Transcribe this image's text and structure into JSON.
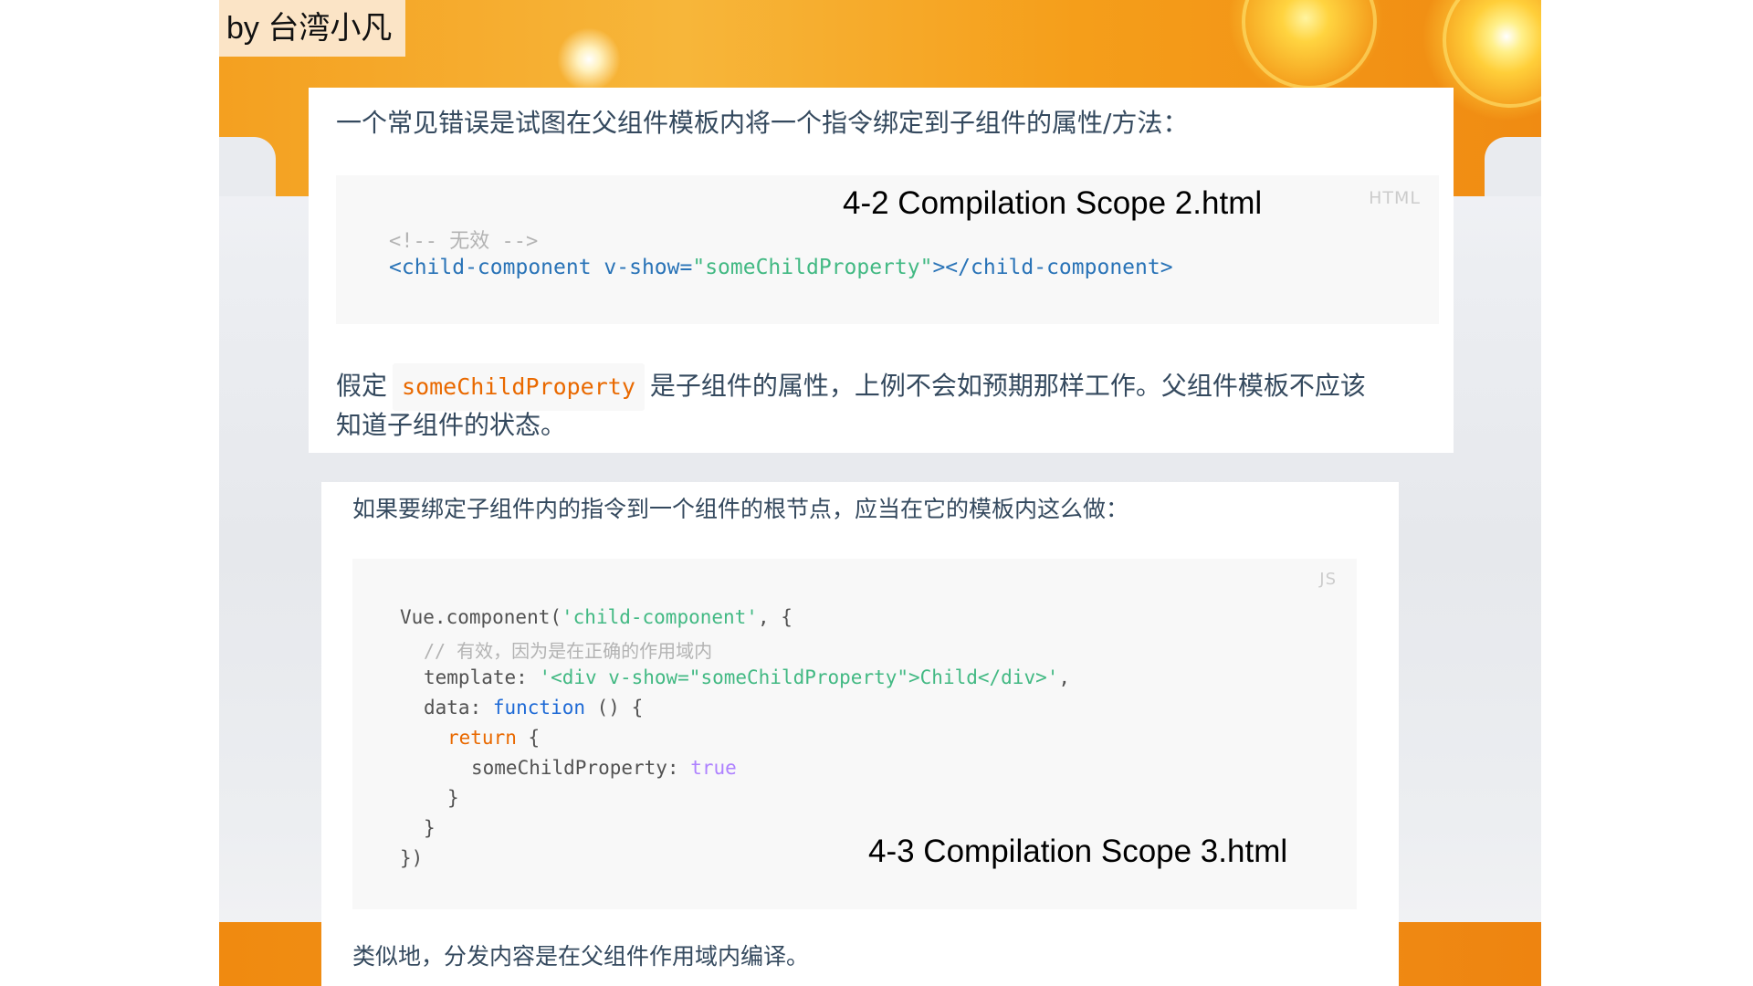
{
  "author_tag": "by 台湾小凡",
  "section1": {
    "intro": "一个常见错误是试图在父组件模板内将一个指令绑定到子组件的属性/方法：",
    "code_lang": "HTML",
    "file_label": "4-2 Compilation Scope 2.html",
    "code_comment": "<!-- 无效 -->",
    "code_line_open": "<child-component v-show=",
    "code_line_value": "\"someChildProperty\"",
    "code_line_close": "></child-component>",
    "para_before": "假定",
    "inline_code": "someChildProperty",
    "para_after": "是子组件的属性，上例不会如预期那样工作。父组件模板不应该",
    "para_line2": "知道子组件的状态。"
  },
  "section2": {
    "intro": "如果要绑定子组件内的指令到一个组件的根节点，应当在它的模板内这么做：",
    "code_lang": "JS",
    "file_label": "4-3 Compilation Scope 3.html",
    "l1_a": "Vue.component(",
    "l1_b": "'child-component'",
    "l1_c": ", {",
    "l2": "// 有效，因为是在正确的作用域内",
    "l3_a": "template: ",
    "l3_b": "'<div v-show=\"someChildProperty\">Child</div>'",
    "l3_c": ",",
    "l4_a": "data: ",
    "l4_b": "function",
    "l4_c": " () {",
    "l5_a": "return",
    "l5_b": " {",
    "l6_a": "someChildProperty: ",
    "l6_b": "true",
    "l7": "}",
    "l8": "}",
    "l9": "})",
    "closing_text": "类似地，分发内容是在父组件作用域内编译。"
  }
}
